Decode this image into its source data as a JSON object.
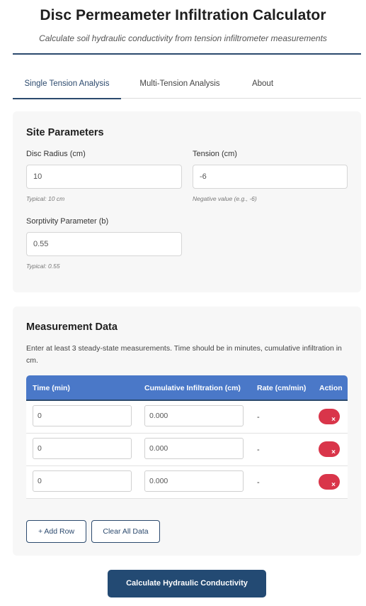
{
  "header": {
    "title": "Disc Permeameter Infiltration Calculator",
    "subtitle": "Calculate soil hydraulic conductivity from tension infiltrometer measurements"
  },
  "tabs": [
    {
      "label": "Single Tension Analysis",
      "active": true
    },
    {
      "label": "Multi-Tension Analysis",
      "active": false
    },
    {
      "label": "About",
      "active": false
    }
  ],
  "site": {
    "title": "Site Parameters",
    "disc_radius": {
      "label": "Disc Radius (cm)",
      "value": "10",
      "hint": "Typical: 10 cm"
    },
    "tension": {
      "label": "Tension (cm)",
      "value": "-6",
      "hint": "Negative value (e.g., -6)"
    },
    "sorptivity": {
      "label": "Sorptivity Parameter (b)",
      "value": "0.55",
      "hint": "Typical: 0.55"
    }
  },
  "measurement": {
    "title": "Measurement Data",
    "description": "Enter at least 3 steady-state measurements. Time should be in minutes, cumulative infiltration in cm.",
    "columns": [
      "Time (min)",
      "Cumulative Infiltration (cm)",
      "Rate (cm/min)",
      "Action"
    ],
    "rows": [
      {
        "time": "0",
        "cumulative": "0.000",
        "rate": "-",
        "action_icon": "×"
      },
      {
        "time": "0",
        "cumulative": "0.000",
        "rate": "-",
        "action_icon": "×"
      },
      {
        "time": "0",
        "cumulative": "0.000",
        "rate": "-",
        "action_icon": "×"
      }
    ],
    "add_row_label": "+ Add Row",
    "clear_all_label": "Clear All Data"
  },
  "calculate_label": "Calculate Hydraulic Conductivity",
  "colors": {
    "primary": "#234a73",
    "accent_header": "#4a78c8",
    "danger": "#d9354a"
  }
}
